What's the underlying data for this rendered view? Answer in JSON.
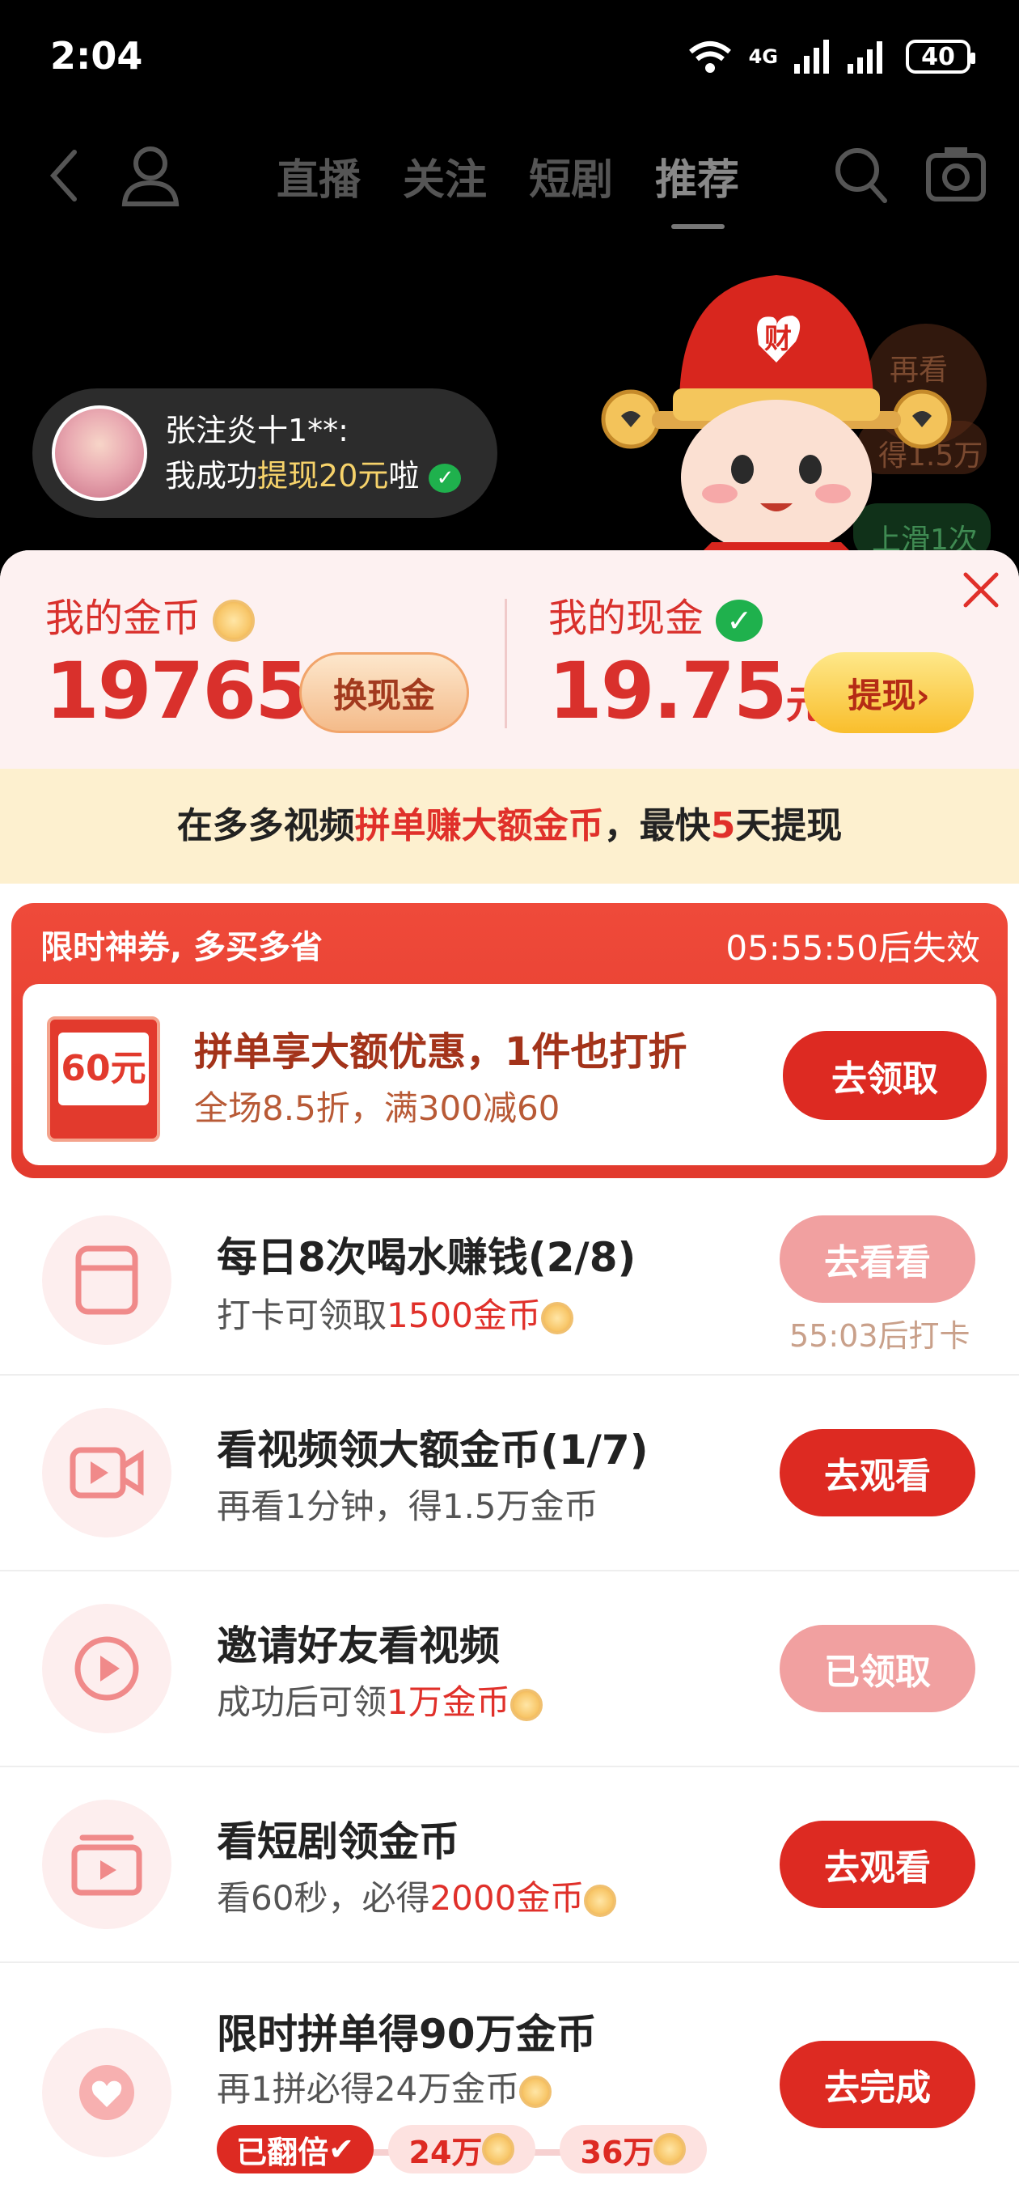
{
  "status": {
    "time": "2:04",
    "network": "4G",
    "battery": "40"
  },
  "nav": {
    "tabs": [
      "直播",
      "关注",
      "短剧",
      "推荐"
    ],
    "active": "推荐"
  },
  "toast": {
    "user": "张注炎十1**:",
    "msg_pre": "我成功",
    "msg_hl": "提现20元",
    "msg_post": "啦"
  },
  "bg": {
    "rewatch": "再看",
    "get": "得1.5万",
    "swipe": "上滑1次"
  },
  "wallet": {
    "coins_label": "我的金币",
    "coins": "19765",
    "exchange_button": "换现金",
    "cash_label": "我的现金",
    "cash": "19.75",
    "cash_unit": "元",
    "withdraw_button": "提现›"
  },
  "banner": {
    "pre": "在多多视频",
    "hl": "拼单赚大额金币",
    "mid": "，最快",
    "num": "5",
    "post": "天提现"
  },
  "coupon": {
    "header": "限时神券, 多买多省",
    "countdown": "05:55:50后失效",
    "ticket_value": "60元",
    "title": "拼单享大额优惠，1件也打折",
    "subtitle": "全场8.5折，满300减60",
    "button": "去领取"
  },
  "tasks": [
    {
      "title": "每日8次喝水赚钱(2/8)",
      "sub_pre": "打卡可领取",
      "sub_hl": "1500金币",
      "button": "去看看",
      "note": "55:03后打卡",
      "icon": "cup-icon"
    },
    {
      "title": "看视频领大额金币(1/7)",
      "sub_pre": "",
      "sub_hl": "再看1分钟，得1.5万金币",
      "button": "去观看",
      "icon": "video-camera-icon"
    },
    {
      "title": "邀请好友看视频",
      "sub_pre": "成功后可领",
      "sub_hl": "1万金币",
      "button": "已领取",
      "icon": "play-circle-icon"
    },
    {
      "title": "看短剧领金币",
      "sub_pre": "看60秒，必得",
      "sub_hl": "2000金币",
      "button": "去观看",
      "icon": "drama-tv-icon"
    },
    {
      "title": "限时拼单得90万金币",
      "sub_pre": "再1拼必得24万金币",
      "sub_hl": "",
      "button": "去完成",
      "icon": "heart-icon",
      "chips": [
        "已翻倍",
        "24万",
        "36万"
      ]
    }
  ]
}
